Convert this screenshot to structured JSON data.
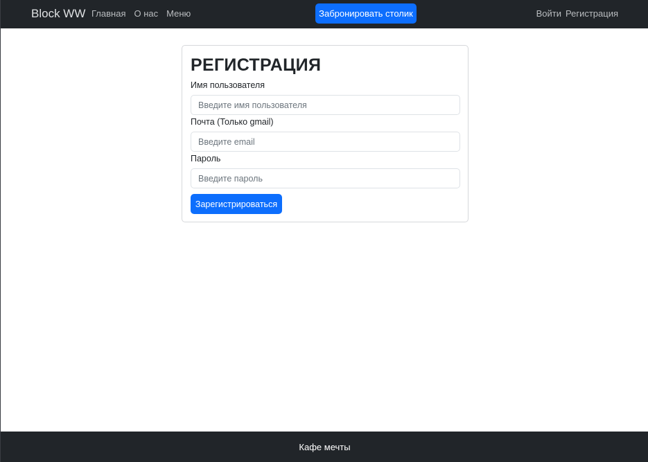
{
  "navbar": {
    "brand": "Block WW",
    "links": [
      "Главная",
      "О нас",
      "Меню"
    ],
    "reserve_label": "Забронировать столик",
    "auth_links": [
      "Войти",
      "Регистрация"
    ]
  },
  "form": {
    "title": "РЕГИСТРАЦИЯ",
    "username_label": "Имя пользователя",
    "username_placeholder": "Введите имя пользователя",
    "email_label": "Почта (Только gmail)",
    "email_placeholder": "Введите email",
    "password_label": "Пароль",
    "password_placeholder": "Введите пароль",
    "submit_label": "Зарегистрироваться"
  },
  "footer": {
    "text": "Кафе мечты"
  },
  "colors": {
    "navbar_bg": "#212529",
    "primary": "#0d6efd",
    "card_border": "#d6d8db"
  }
}
